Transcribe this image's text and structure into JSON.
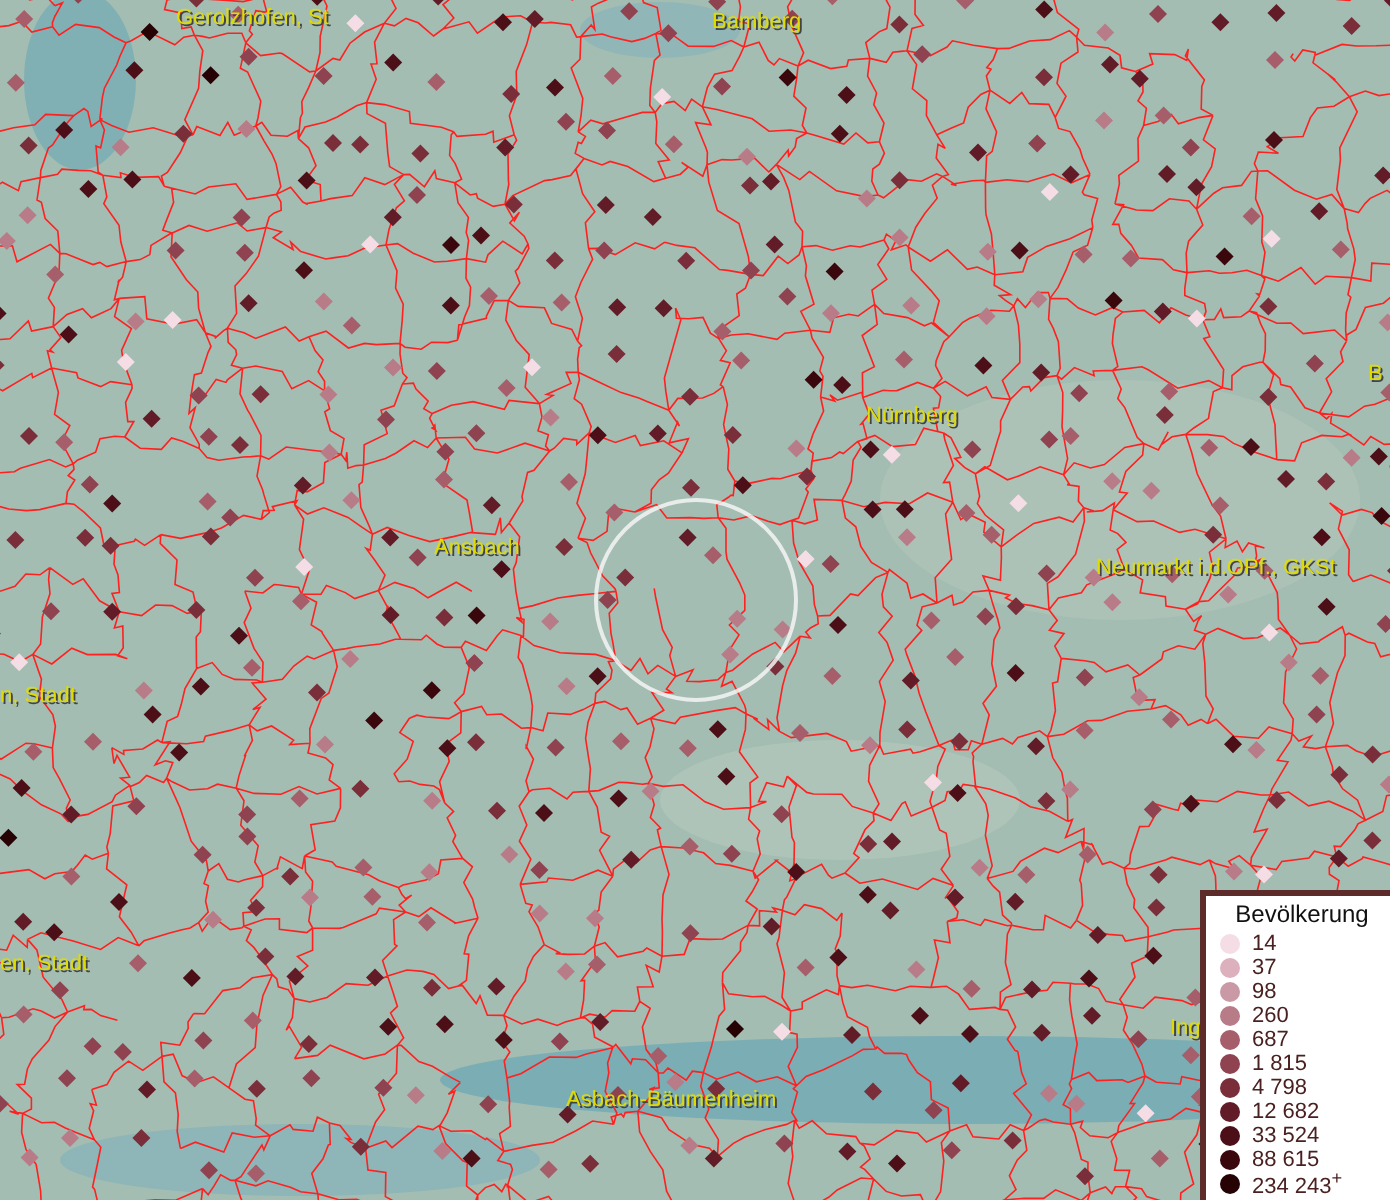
{
  "map": {
    "places": [
      {
        "name": "Gerolzhofen, St"
      },
      {
        "name": "Bamberg"
      },
      {
        "name": "Nürnberg"
      },
      {
        "name": "Ansbach"
      },
      {
        "name": "Neumarkt i.d.OPf., GKSt"
      },
      {
        "name": "n, Stadt"
      },
      {
        "name": "en, Stadt"
      },
      {
        "name": "Asbach-Bäumenheim"
      },
      {
        "name": "Ing"
      },
      {
        "name": "B"
      }
    ]
  },
  "legend": {
    "title": "Bevölkerung",
    "items": [
      {
        "label": "14",
        "color": "#f5dde6"
      },
      {
        "label": "37",
        "color": "#dcb0bd"
      },
      {
        "label": "98",
        "color": "#c99aa5"
      },
      {
        "label": "260",
        "color": "#b87c88"
      },
      {
        "label": "687",
        "color": "#a65e6a"
      },
      {
        "label": "1 815",
        "color": "#8f4250"
      },
      {
        "label": "4 798",
        "color": "#7a2e3a"
      },
      {
        "label": "12 682",
        "color": "#621c27"
      },
      {
        "label": "33 524",
        "color": "#4d0f17"
      },
      {
        "label": "88 615",
        "color": "#3a070d"
      },
      {
        "label": "234 243$^{+}$",
        "color": "#260205"
      }
    ]
  }
}
